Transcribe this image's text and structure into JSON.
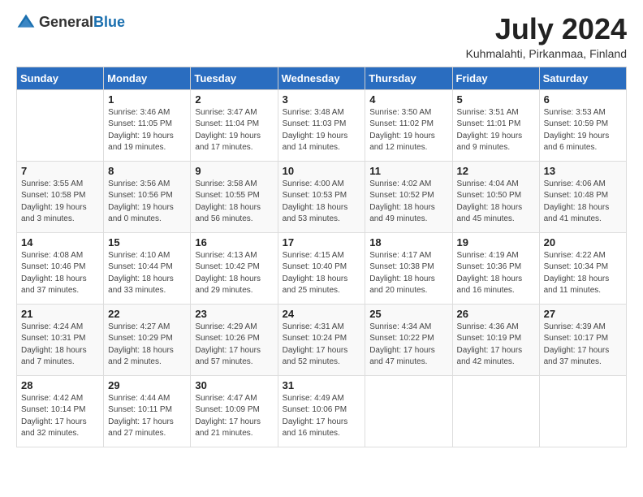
{
  "header": {
    "logo_general": "General",
    "logo_blue": "Blue",
    "title": "July 2024",
    "location": "Kuhmalahti, Pirkanmaa, Finland"
  },
  "columns": [
    "Sunday",
    "Monday",
    "Tuesday",
    "Wednesday",
    "Thursday",
    "Friday",
    "Saturday"
  ],
  "weeks": [
    [
      {
        "day": "",
        "sunrise": "",
        "sunset": "",
        "daylight": ""
      },
      {
        "day": "1",
        "sunrise": "Sunrise: 3:46 AM",
        "sunset": "Sunset: 11:05 PM",
        "daylight": "Daylight: 19 hours and 19 minutes."
      },
      {
        "day": "2",
        "sunrise": "Sunrise: 3:47 AM",
        "sunset": "Sunset: 11:04 PM",
        "daylight": "Daylight: 19 hours and 17 minutes."
      },
      {
        "day": "3",
        "sunrise": "Sunrise: 3:48 AM",
        "sunset": "Sunset: 11:03 PM",
        "daylight": "Daylight: 19 hours and 14 minutes."
      },
      {
        "day": "4",
        "sunrise": "Sunrise: 3:50 AM",
        "sunset": "Sunset: 11:02 PM",
        "daylight": "Daylight: 19 hours and 12 minutes."
      },
      {
        "day": "5",
        "sunrise": "Sunrise: 3:51 AM",
        "sunset": "Sunset: 11:01 PM",
        "daylight": "Daylight: 19 hours and 9 minutes."
      },
      {
        "day": "6",
        "sunrise": "Sunrise: 3:53 AM",
        "sunset": "Sunset: 10:59 PM",
        "daylight": "Daylight: 19 hours and 6 minutes."
      }
    ],
    [
      {
        "day": "7",
        "sunrise": "Sunrise: 3:55 AM",
        "sunset": "Sunset: 10:58 PM",
        "daylight": "Daylight: 19 hours and 3 minutes."
      },
      {
        "day": "8",
        "sunrise": "Sunrise: 3:56 AM",
        "sunset": "Sunset: 10:56 PM",
        "daylight": "Daylight: 19 hours and 0 minutes."
      },
      {
        "day": "9",
        "sunrise": "Sunrise: 3:58 AM",
        "sunset": "Sunset: 10:55 PM",
        "daylight": "Daylight: 18 hours and 56 minutes."
      },
      {
        "day": "10",
        "sunrise": "Sunrise: 4:00 AM",
        "sunset": "Sunset: 10:53 PM",
        "daylight": "Daylight: 18 hours and 53 minutes."
      },
      {
        "day": "11",
        "sunrise": "Sunrise: 4:02 AM",
        "sunset": "Sunset: 10:52 PM",
        "daylight": "Daylight: 18 hours and 49 minutes."
      },
      {
        "day": "12",
        "sunrise": "Sunrise: 4:04 AM",
        "sunset": "Sunset: 10:50 PM",
        "daylight": "Daylight: 18 hours and 45 minutes."
      },
      {
        "day": "13",
        "sunrise": "Sunrise: 4:06 AM",
        "sunset": "Sunset: 10:48 PM",
        "daylight": "Daylight: 18 hours and 41 minutes."
      }
    ],
    [
      {
        "day": "14",
        "sunrise": "Sunrise: 4:08 AM",
        "sunset": "Sunset: 10:46 PM",
        "daylight": "Daylight: 18 hours and 37 minutes."
      },
      {
        "day": "15",
        "sunrise": "Sunrise: 4:10 AM",
        "sunset": "Sunset: 10:44 PM",
        "daylight": "Daylight: 18 hours and 33 minutes."
      },
      {
        "day": "16",
        "sunrise": "Sunrise: 4:13 AM",
        "sunset": "Sunset: 10:42 PM",
        "daylight": "Daylight: 18 hours and 29 minutes."
      },
      {
        "day": "17",
        "sunrise": "Sunrise: 4:15 AM",
        "sunset": "Sunset: 10:40 PM",
        "daylight": "Daylight: 18 hours and 25 minutes."
      },
      {
        "day": "18",
        "sunrise": "Sunrise: 4:17 AM",
        "sunset": "Sunset: 10:38 PM",
        "daylight": "Daylight: 18 hours and 20 minutes."
      },
      {
        "day": "19",
        "sunrise": "Sunrise: 4:19 AM",
        "sunset": "Sunset: 10:36 PM",
        "daylight": "Daylight: 18 hours and 16 minutes."
      },
      {
        "day": "20",
        "sunrise": "Sunrise: 4:22 AM",
        "sunset": "Sunset: 10:34 PM",
        "daylight": "Daylight: 18 hours and 11 minutes."
      }
    ],
    [
      {
        "day": "21",
        "sunrise": "Sunrise: 4:24 AM",
        "sunset": "Sunset: 10:31 PM",
        "daylight": "Daylight: 18 hours and 7 minutes."
      },
      {
        "day": "22",
        "sunrise": "Sunrise: 4:27 AM",
        "sunset": "Sunset: 10:29 PM",
        "daylight": "Daylight: 18 hours and 2 minutes."
      },
      {
        "day": "23",
        "sunrise": "Sunrise: 4:29 AM",
        "sunset": "Sunset: 10:26 PM",
        "daylight": "Daylight: 17 hours and 57 minutes."
      },
      {
        "day": "24",
        "sunrise": "Sunrise: 4:31 AM",
        "sunset": "Sunset: 10:24 PM",
        "daylight": "Daylight: 17 hours and 52 minutes."
      },
      {
        "day": "25",
        "sunrise": "Sunrise: 4:34 AM",
        "sunset": "Sunset: 10:22 PM",
        "daylight": "Daylight: 17 hours and 47 minutes."
      },
      {
        "day": "26",
        "sunrise": "Sunrise: 4:36 AM",
        "sunset": "Sunset: 10:19 PM",
        "daylight": "Daylight: 17 hours and 42 minutes."
      },
      {
        "day": "27",
        "sunrise": "Sunrise: 4:39 AM",
        "sunset": "Sunset: 10:17 PM",
        "daylight": "Daylight: 17 hours and 37 minutes."
      }
    ],
    [
      {
        "day": "28",
        "sunrise": "Sunrise: 4:42 AM",
        "sunset": "Sunset: 10:14 PM",
        "daylight": "Daylight: 17 hours and 32 minutes."
      },
      {
        "day": "29",
        "sunrise": "Sunrise: 4:44 AM",
        "sunset": "Sunset: 10:11 PM",
        "daylight": "Daylight: 17 hours and 27 minutes."
      },
      {
        "day": "30",
        "sunrise": "Sunrise: 4:47 AM",
        "sunset": "Sunset: 10:09 PM",
        "daylight": "Daylight: 17 hours and 21 minutes."
      },
      {
        "day": "31",
        "sunrise": "Sunrise: 4:49 AM",
        "sunset": "Sunset: 10:06 PM",
        "daylight": "Daylight: 17 hours and 16 minutes."
      },
      {
        "day": "",
        "sunrise": "",
        "sunset": "",
        "daylight": ""
      },
      {
        "day": "",
        "sunrise": "",
        "sunset": "",
        "daylight": ""
      },
      {
        "day": "",
        "sunrise": "",
        "sunset": "",
        "daylight": ""
      }
    ]
  ]
}
